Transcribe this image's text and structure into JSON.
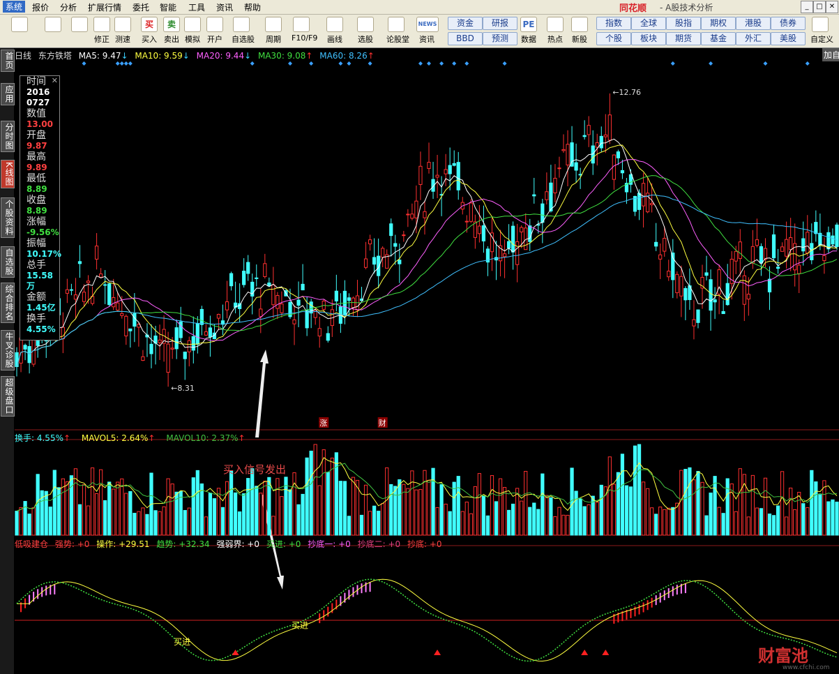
{
  "menu": {
    "items": [
      "系统",
      "报价",
      "分析",
      "扩展行情",
      "委托",
      "智能",
      "工具",
      "资讯",
      "帮助"
    ],
    "active_index": 0,
    "brand": "同花顺",
    "subtitle": "- A股技术分析"
  },
  "toolbar": {
    "buttons": [
      {
        "label": "",
        "icon": "windows-icon"
      },
      {
        "label": "",
        "icon": "back-arrow-icon"
      },
      {
        "label": "",
        "icon": "up-down-arrow-icon"
      },
      {
        "label": "修正",
        "icon": "refresh-icon"
      },
      {
        "label": "测速",
        "icon": "clock-icon"
      },
      {
        "label": "买入",
        "icon": "buy-icon",
        "glyph": "买"
      },
      {
        "label": "卖出",
        "icon": "sell-icon",
        "glyph": "卖"
      },
      {
        "label": "模拟",
        "icon": "hammer-icon"
      },
      {
        "label": "开户",
        "icon": "lock-icon"
      },
      {
        "label": "自选股",
        "icon": "star-icon"
      },
      {
        "label": "周期",
        "icon": "cycle-icon"
      },
      {
        "label": "F10/F9",
        "icon": "f10-icon"
      },
      {
        "label": "画线",
        "icon": "pen-icon"
      },
      {
        "label": "选股",
        "icon": "screen-icon"
      },
      {
        "label": "论股堂",
        "icon": "forum-icon"
      },
      {
        "label": "资讯",
        "icon": "news-icon",
        "glyph": "NEWS"
      },
      {
        "label": "数据",
        "icon": "pe-icon",
        "glyph": "PE"
      },
      {
        "label": "热点",
        "icon": "hot-icon"
      },
      {
        "label": "新股",
        "icon": "ipo-icon"
      },
      {
        "label": "自定义",
        "icon": "custom-icon"
      }
    ],
    "grid_left": [
      "资金",
      "研报",
      "BBD",
      "预测"
    ],
    "grid_right": [
      "指数",
      "全球",
      "股指",
      "期权",
      "港股",
      "债券",
      "个股",
      "板块",
      "期货",
      "基金",
      "外汇",
      "美股"
    ]
  },
  "sidebar": [
    "首页",
    "应用",
    "分时图",
    "K线图",
    "个股资料",
    "自选股",
    "综合排名",
    "牛叉诊股",
    "超级盘口"
  ],
  "sidebar_active": 3,
  "price_legend": {
    "period": "日线",
    "name": "东方铁塔",
    "ma5": "MA5: 9.47",
    "ma10": "MA10: 9.59",
    "ma20": "MA20: 9.44",
    "ma30": "MA30: 9.08",
    "ma60": "MA60: 8.26",
    "add_label": "加自"
  },
  "arrows": {
    "ma5": "↓",
    "ma10": "↓",
    "ma20": "↓",
    "ma30": "↑",
    "ma60": "↑"
  },
  "colors": {
    "ma5": "#ffffff",
    "ma10": "#ffff40",
    "ma20": "#ff60ff",
    "ma30": "#40e040",
    "ma60": "#40c0ff",
    "up": "#ff3030",
    "down": "#40ffff",
    "grid": "#8b1a1a",
    "bg": "#000000"
  },
  "info": {
    "rows": [
      {
        "label": "时间",
        "value": "2016",
        "color": "#ffffff"
      },
      {
        "label": "",
        "value": "0727",
        "color": "#ffffff"
      },
      {
        "label": "数值",
        "value": "13.00",
        "color": "#ff4040"
      },
      {
        "label": "开盘",
        "value": "9.87",
        "color": "#ff4040"
      },
      {
        "label": "最高",
        "value": "9.89",
        "color": "#ff4040"
      },
      {
        "label": "最低",
        "value": "8.89",
        "color": "#40e040"
      },
      {
        "label": "收盘",
        "value": "8.89",
        "color": "#40e040"
      },
      {
        "label": "涨幅",
        "value": "-9.56%",
        "color": "#40e040"
      },
      {
        "label": "振幅",
        "value": "10.17%",
        "color": "#40ffff"
      },
      {
        "label": "总手",
        "value": "15.58万",
        "color": "#40ffff"
      },
      {
        "label": "金额",
        "value": "1.45亿",
        "color": "#40ffff"
      },
      {
        "label": "换手",
        "value": "4.55%",
        "color": "#40ffff"
      }
    ]
  },
  "price_marks": {
    "high": "12.76",
    "low": "8.31"
  },
  "event_marks": [
    "涨",
    "财"
  ],
  "volume_legend": {
    "turnover": "换手: 4.55%",
    "mavol5": "MAVOL5: 2.64%",
    "mavol10": "MAVOL10: 2.37%",
    "arrow": "↑"
  },
  "indicator_legend": {
    "name": "低吸建仓",
    "strong": "强势: +0",
    "operate": "操作: +29.51",
    "trend": "趋势: +32.34",
    "boundary": "强弱界: +0",
    "buy": "买进: +0",
    "bottom1": "抄底一: +0",
    "bottom2": "抄底二: +0",
    "bottom": "抄底: +0"
  },
  "annotation": "买入信号发出",
  "buy_labels": [
    "买进",
    "买进"
  ],
  "watermark": {
    "text": "财富池",
    "url": "www.cfchi.com"
  },
  "chart_data": {
    "type": "candlestick",
    "symbol": "东方铁塔",
    "ma_values": {
      "MA5": 9.47,
      "MA10": 9.59,
      "MA20": 9.44,
      "MA30": 9.08,
      "MA60": 8.26
    },
    "visible_high": 12.76,
    "visible_low": 8.31,
    "selected_bar": {
      "date": "20160727",
      "open": 9.87,
      "high": 9.89,
      "low": 8.89,
      "close": 8.89,
      "change_pct": -9.56,
      "amplitude_pct": 10.17,
      "volume": "15.58万",
      "amount": "1.45亿",
      "turnover_pct": 4.55
    },
    "ylim": [
      7.4,
      13.3
    ]
  }
}
